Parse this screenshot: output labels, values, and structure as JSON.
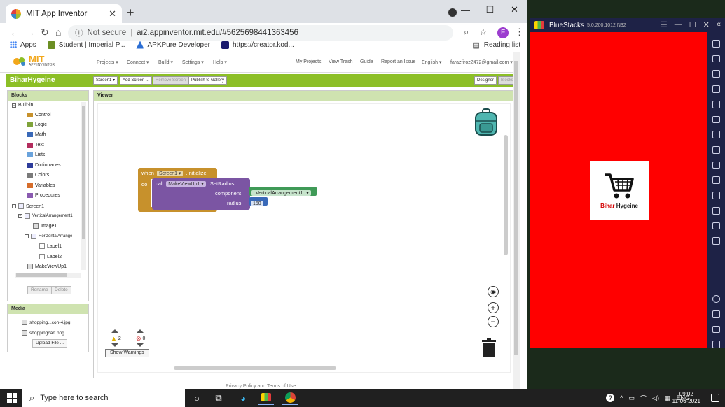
{
  "browser": {
    "tab_title": "MIT App Inventor",
    "security_label": "Not secure",
    "url": "ai2.appinventor.mit.edu/#5625698441363456",
    "profile_initial": "F",
    "bookmarks": [
      {
        "label": "Apps"
      },
      {
        "label": "Student | Imperial P..."
      },
      {
        "label": "APKPure Developer"
      },
      {
        "label": "https://creator.kod..."
      }
    ],
    "reading_list": "Reading list"
  },
  "appinventor": {
    "logo_text": "MIT",
    "logo_sub": "APP INVENTOR",
    "menu": [
      "Projects ▾",
      "Connect ▾",
      "Build ▾",
      "Settings ▾",
      "Help ▾"
    ],
    "right_menu": [
      "My Projects",
      "View Trash",
      "Guide",
      "Report an Issue",
      "English ▾",
      "farazfiroz2472@gmail.com ▾"
    ],
    "project_name": "BiharHygeine",
    "project_buttons": [
      "Screen1 ▾",
      "Add Screen ...",
      "Remove Screen",
      "Publish to Gallery"
    ],
    "view_buttons": [
      "Designer",
      "Blocks"
    ],
    "blocks_panel": {
      "title": "Blocks",
      "builtin_label": "Built-in",
      "builtins": [
        {
          "label": "Control",
          "color": "#c7912c"
        },
        {
          "label": "Logic",
          "color": "#7fa33a"
        },
        {
          "label": "Math",
          "color": "#3969b8"
        },
        {
          "label": "Text",
          "color": "#b32d5e"
        },
        {
          "label": "Lists",
          "color": "#6aa3dc"
        },
        {
          "label": "Dictionaries",
          "color": "#2d3c9b"
        },
        {
          "label": "Colors",
          "color": "#7a7a7a"
        },
        {
          "label": "Variables",
          "color": "#d66d2b"
        },
        {
          "label": "Procedures",
          "color": "#8a5ab0"
        }
      ],
      "components": [
        "Screen1",
        "VerticalArrangement1",
        "Image1",
        "HorizontalArrange",
        "Label1",
        "Label2",
        "MakeViewUp1"
      ],
      "rename_button": "Rename",
      "delete_button": "Delete"
    },
    "media_panel": {
      "title": "Media",
      "items": [
        "shopping...con-4.jpg",
        "shoppingcart.png"
      ],
      "upload_button": "Upload File ..."
    },
    "viewer": {
      "title": "Viewer",
      "event_when": "when",
      "event_component": "Screen1",
      "event_name": ".Initialize",
      "event_do": "do",
      "call_label": "call",
      "call_component": "MakeViewUp1",
      "call_method": ".SetRadius",
      "param_component": "component",
      "param_radius": "radius",
      "component_value": "VerticalArrangement1",
      "radius_value": "150",
      "warnings_count": "2",
      "errors_count": "0",
      "show_warnings": "Show Warnings"
    },
    "footer": "Privacy Policy and Terms of Use"
  },
  "bluestacks": {
    "name": "BlueStacks",
    "version": "5.0.200.1012 N32",
    "screen_color": "#ff0000",
    "card_label_black": "Bihar",
    "card_label_red": "Hygeine"
  },
  "taskbar": {
    "search_placeholder": "Type here to search",
    "language": "ENG",
    "time": "09:02",
    "date": "11-06-2021"
  }
}
